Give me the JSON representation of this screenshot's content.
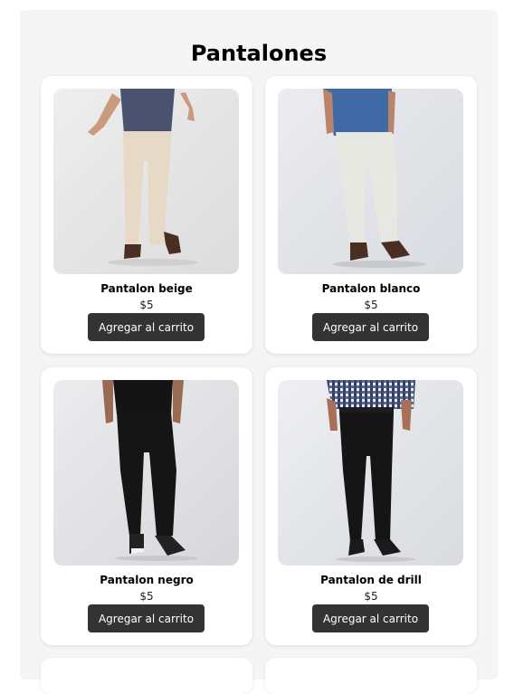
{
  "page": {
    "title": "Pantalones"
  },
  "products": [
    {
      "name": "Pantalon beige",
      "price": "$5",
      "button": "Agregar al carrito",
      "image": "beige-pants-photo"
    },
    {
      "name": "Pantalon blanco",
      "price": "$5",
      "button": "Agregar al carrito",
      "image": "white-pants-photo"
    },
    {
      "name": "Pantalon negro",
      "price": "$5",
      "button": "Agregar al carrito",
      "image": "black-pants-photo"
    },
    {
      "name": "Pantalon de drill",
      "price": "$5",
      "button": "Agregar al carrito",
      "image": "drill-pants-photo"
    }
  ],
  "colors": {
    "page_bg": "#f5f5f5",
    "card_bg": "#ffffff",
    "button_bg": "#333333",
    "button_text": "#ffffff"
  }
}
